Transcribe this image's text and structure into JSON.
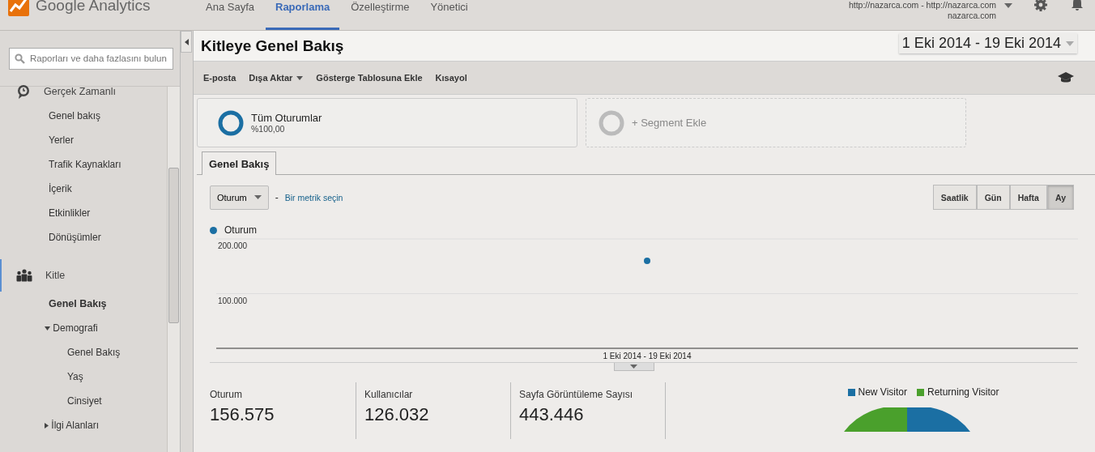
{
  "nav": {
    "logo_text": "Google Analytics",
    "tabs": [
      {
        "label": "Ana Sayfa",
        "selected": false
      },
      {
        "label": "Raporlama",
        "selected": true
      },
      {
        "label": "Özelleştirme",
        "selected": false
      },
      {
        "label": "Yönetici",
        "selected": false
      }
    ],
    "account": {
      "property": "http://nazarca.com - http://nazarca.com",
      "view": "nazarca.com"
    }
  },
  "sidebar": {
    "search_placeholder": "Raporları ve daha fazlasını bulun",
    "sections": [
      {
        "label": "Gerçek Zamanlı",
        "kind": "realtime",
        "active": false,
        "children": [
          {
            "label": "Genel bakış",
            "selected": false
          },
          {
            "label": "Yerler",
            "selected": false
          },
          {
            "label": "Trafik Kaynakları",
            "selected": false
          },
          {
            "label": "İçerik",
            "selected": false
          },
          {
            "label": "Etkinlikler",
            "selected": false
          },
          {
            "label": "Dönüşümler",
            "selected": false
          }
        ]
      },
      {
        "label": "Kitle",
        "kind": "audience",
        "active": true,
        "children": [
          {
            "label": "Genel Bakış",
            "selected": true
          },
          {
            "label": "Demografi",
            "selected": false,
            "expanded": true,
            "children": [
              {
                "label": "Genel Bakış",
                "selected": false
              },
              {
                "label": "Yaş",
                "selected": false
              },
              {
                "label": "Cinsiyet",
                "selected": false
              }
            ]
          },
          {
            "label": "İlgi Alanları",
            "selected": false,
            "expanded": false
          }
        ]
      }
    ]
  },
  "header": {
    "title": "Kitleye Genel Bakış",
    "date_range": "1 Eki 2014 - 19 Eki 2014"
  },
  "toolbar": [
    {
      "label": "E-posta",
      "dropdown": false
    },
    {
      "label": "Dışa Aktar",
      "dropdown": true
    },
    {
      "label": "Gösterge Tablosuna Ekle",
      "dropdown": false
    },
    {
      "label": "Kısayol",
      "dropdown": false
    }
  ],
  "segments": [
    {
      "kind": "segment",
      "label": "Tüm Oturumlar",
      "percent": "%100,00"
    },
    {
      "kind": "add",
      "label": "+ Segment Ekle"
    }
  ],
  "tabs": [
    {
      "label": "Genel Bakış",
      "selected": true
    }
  ],
  "metric_picker": {
    "value": "Oturum",
    "separator": "-",
    "link": "Bir metrik seçin"
  },
  "granularity": [
    {
      "label": "Saatlik",
      "selected": false
    },
    {
      "label": "Gün",
      "selected": false
    },
    {
      "label": "Hafta",
      "selected": false
    },
    {
      "label": "Ay",
      "selected": true
    }
  ],
  "chart": {
    "chart_data": {
      "type": "line",
      "categories": [
        "1 Eki 2014 - 19 Eki 2014"
      ],
      "series": [
        {
          "name": "Oturum",
          "color": "#1b6fa3",
          "marker": true,
          "values": [
            160000
          ]
        }
      ],
      "ylim": [
        0,
        200000
      ],
      "yticks": [
        {
          "value": 100000,
          "label": "100.000"
        },
        {
          "value": 200000,
          "label": "200.000"
        }
      ]
    }
  },
  "metrics": [
    {
      "label": "Oturum",
      "value": "156.575"
    },
    {
      "label": "Kullanıcılar",
      "value": "126.032"
    },
    {
      "label": "Sayfa Görüntüleme Sayısı",
      "value": "443.446"
    }
  ],
  "visitor_legend": [
    {
      "label": "New Visitor",
      "color": "#1b6fa3"
    },
    {
      "label": "Returning Visitor",
      "color": "#4aa02c"
    }
  ]
}
